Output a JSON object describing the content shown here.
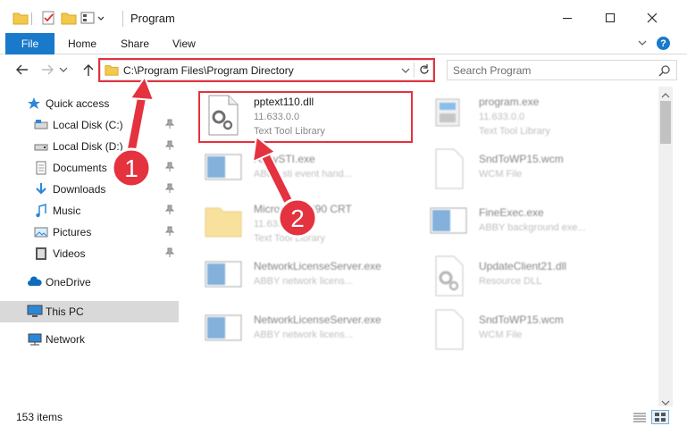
{
  "window": {
    "title": "Program",
    "minimize_glyph": "—",
    "maximize_glyph": "☐",
    "close_glyph": "✕"
  },
  "ribbon": {
    "tabs": [
      "File",
      "Home",
      "Share",
      "View"
    ],
    "help_glyph": "?"
  },
  "nav": {
    "address": "C:\\Program Files\\Program Directory",
    "search_placeholder": "Search Program"
  },
  "sidebar": {
    "items": [
      {
        "label": "Quick access",
        "icon": "star-icon"
      },
      {
        "label": "Local Disk (C:)",
        "icon": "drive-icon"
      },
      {
        "label": "Local Disk (D:)",
        "icon": "drive-icon"
      },
      {
        "label": "Documents",
        "icon": "documents-icon"
      },
      {
        "label": "Downloads",
        "icon": "download-icon"
      },
      {
        "label": "Music",
        "icon": "music-icon"
      },
      {
        "label": "Pictures",
        "icon": "pictures-icon"
      },
      {
        "label": "Videos",
        "icon": "videos-icon"
      },
      {
        "label": "OneDrive",
        "icon": "cloud-icon"
      },
      {
        "label": "This PC",
        "icon": "computer-icon"
      },
      {
        "label": "Network",
        "icon": "network-icon"
      }
    ]
  },
  "files": [
    {
      "name": "pptext110.dll",
      "version": "11.633.0.0",
      "description": "Text Tool Library",
      "icon": "dll-gear-icon"
    },
    {
      "name": "program.exe",
      "version": "11.633.0.0",
      "description": "Text Tool Library",
      "icon": "exe-icon"
    },
    {
      "name": "AbbySTI.exe",
      "version": "",
      "description": "ABBY sti event hand...",
      "icon": "exe-window-icon"
    },
    {
      "name": "SndToWP15.wcm",
      "version": "",
      "description": "WCM File",
      "icon": "blank-file-icon"
    },
    {
      "name": "Microsoft VC90 CRT",
      "version": "11.633.0.0",
      "description": "Text Tool Library",
      "icon": "folder-icon"
    },
    {
      "name": "FineExec.exe",
      "version": "",
      "description": "ABBY background exe...",
      "icon": "exe-window-icon"
    },
    {
      "name": "NetworkLicenseServer.exe",
      "version": "",
      "description": "ABBY network licens...",
      "icon": "exe-window-icon"
    },
    {
      "name": "UpdateClient21.dll",
      "version": "",
      "description": "Resource DLL",
      "icon": "dll-gear-icon"
    },
    {
      "name": "NetworkLicenseServer.exe",
      "version": "",
      "description": "ABBY network licens...",
      "icon": "exe-window-icon"
    },
    {
      "name": "SndToWP15.wcm",
      "version": "",
      "description": "WCM File",
      "icon": "blank-file-icon"
    }
  ],
  "annotations": {
    "step1": "1",
    "step2": "2",
    "color": "#e4323f"
  },
  "status": {
    "items_count": "153 items"
  },
  "colors": {
    "accent": "#1979ca",
    "highlight": "#e4323f",
    "selected_bg": "#cce8ff"
  }
}
